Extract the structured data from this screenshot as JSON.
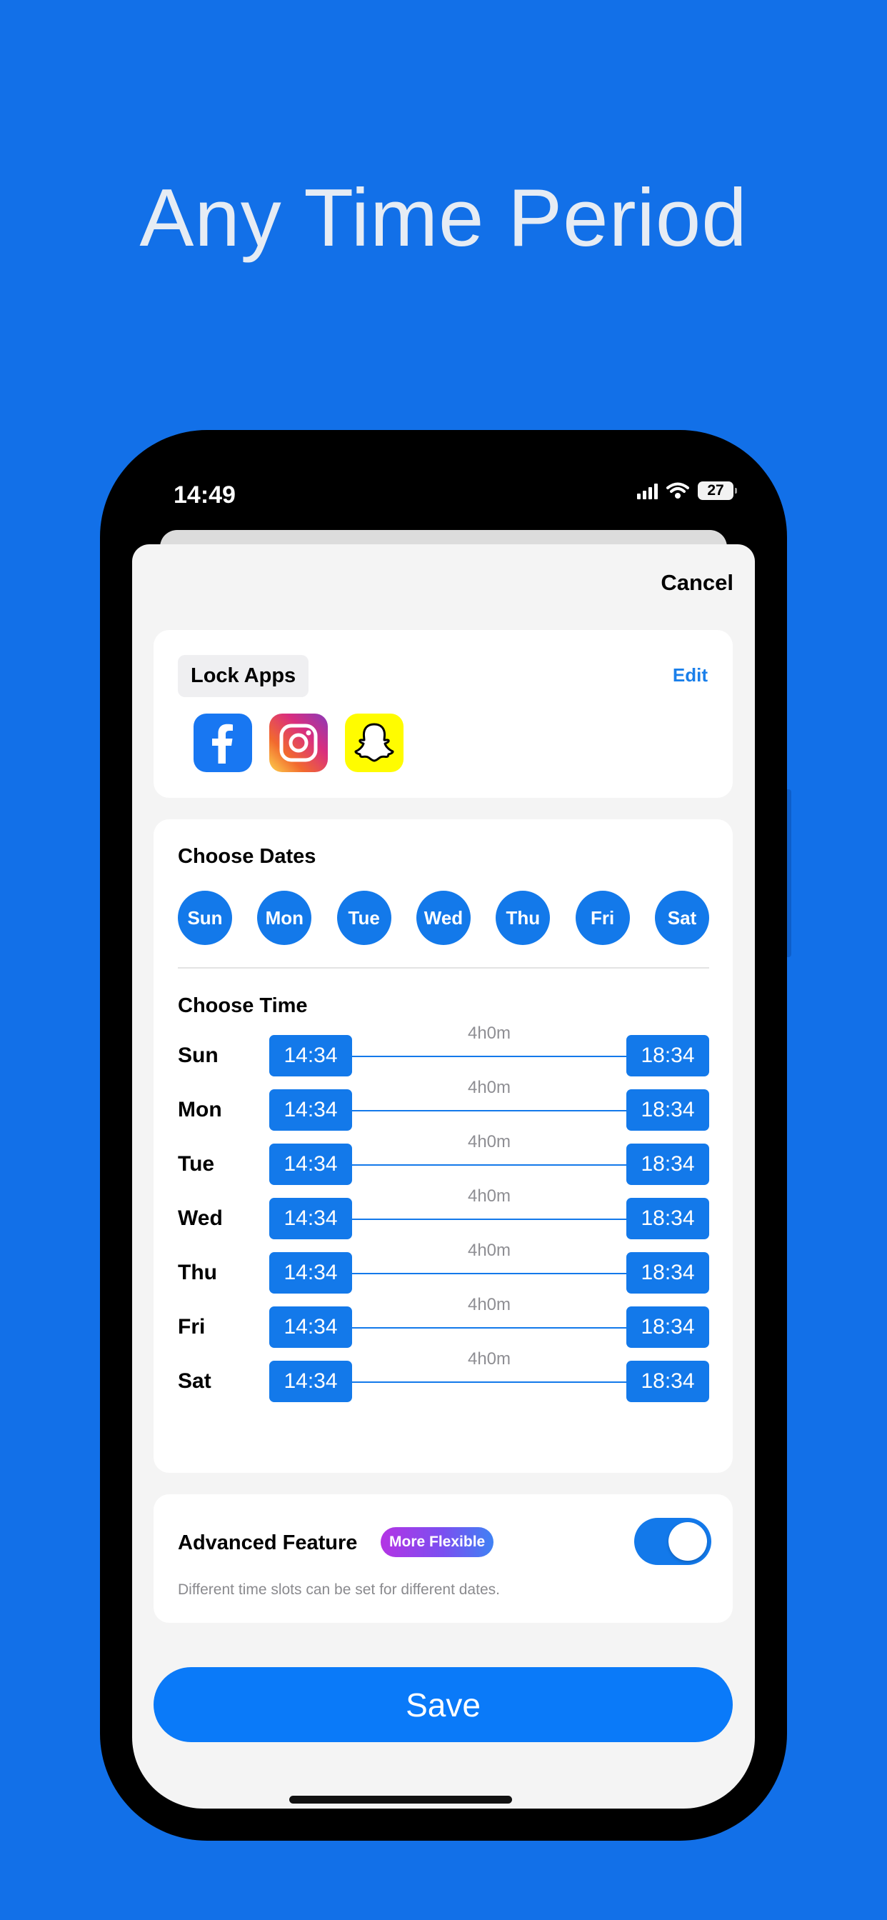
{
  "headline": "Any Time Period",
  "status_bar": {
    "time": "14:49",
    "battery": "27"
  },
  "header": {
    "cancel_label": "Cancel"
  },
  "lock_apps": {
    "title": "Lock Apps",
    "edit_label": "Edit",
    "apps": [
      "facebook-icon",
      "instagram-icon",
      "snapchat-icon"
    ]
  },
  "choose_dates": {
    "title": "Choose Dates",
    "days": [
      "Sun",
      "Mon",
      "Tue",
      "Wed",
      "Thu",
      "Fri",
      "Sat"
    ]
  },
  "choose_time": {
    "title": "Choose Time",
    "rows": [
      {
        "day": "Sun",
        "start": "14:34",
        "end": "18:34",
        "duration": "4h0m"
      },
      {
        "day": "Mon",
        "start": "14:34",
        "end": "18:34",
        "duration": "4h0m"
      },
      {
        "day": "Tue",
        "start": "14:34",
        "end": "18:34",
        "duration": "4h0m"
      },
      {
        "day": "Wed",
        "start": "14:34",
        "end": "18:34",
        "duration": "4h0m"
      },
      {
        "day": "Thu",
        "start": "14:34",
        "end": "18:34",
        "duration": "4h0m"
      },
      {
        "day": "Fri",
        "start": "14:34",
        "end": "18:34",
        "duration": "4h0m"
      },
      {
        "day": "Sat",
        "start": "14:34",
        "end": "18:34",
        "duration": "4h0m"
      }
    ]
  },
  "advanced": {
    "title": "Advanced Feature",
    "badge": "More Flexible",
    "enabled": true,
    "description": "Different time slots can be set for different dates."
  },
  "save_label": "Save",
  "colors": {
    "background": "#1270E8",
    "accent": "#1379EA",
    "save": "#0A7AF9"
  }
}
